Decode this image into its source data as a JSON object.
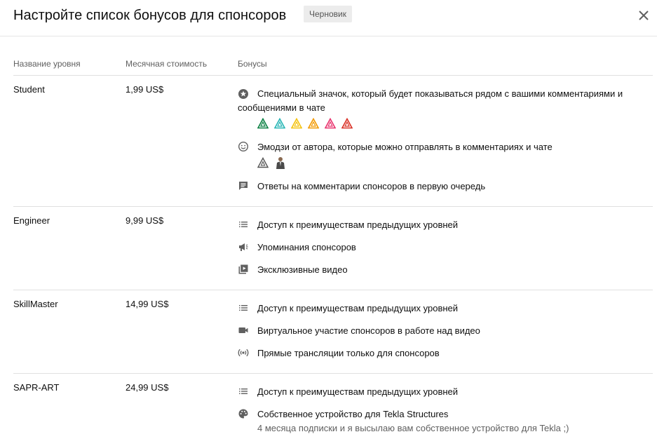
{
  "dialog": {
    "title": "Настройте список бонусов для спонсоров",
    "status_badge": "Черновик"
  },
  "table": {
    "col_tier": "Название уровня",
    "col_price": "Месячная стоимость",
    "col_perks": "Бонусы"
  },
  "colors": {
    "loyalty_badges": [
      "#0b8043",
      "#26b5b5",
      "#f4c20d",
      "#f29900",
      "#e8336d",
      "#d93025"
    ]
  },
  "tiers": [
    {
      "name": "Student",
      "price": "1,99 US$",
      "perks": [
        {
          "icon": "star-badge-icon",
          "text": "Специальный значок, который будет показываться рядом с вашими комментариями и сообщениями в чате"
        },
        {
          "icon": "smiley-icon",
          "text": "Эмодзи от автора, которые можно отправлять в комментариях и чате"
        },
        {
          "icon": "comment-icon",
          "text": "Ответы на комментарии спонсоров в первую очередь"
        }
      ]
    },
    {
      "name": "Engineer",
      "price": "9,99 US$",
      "perks": [
        {
          "icon": "list-icon",
          "text": "Доступ к преимуществам предыдущих уровней"
        },
        {
          "icon": "megaphone-icon",
          "text": "Упоминания спонсоров"
        },
        {
          "icon": "video-library-icon",
          "text": "Эксклюзивные видео"
        }
      ]
    },
    {
      "name": "SkillMaster",
      "price": "14,99 US$",
      "perks": [
        {
          "icon": "list-icon",
          "text": "Доступ к преимуществам предыдущих уровней"
        },
        {
          "icon": "camera-icon",
          "text": "Виртуальное участие спонсоров в работе над видео"
        },
        {
          "icon": "live-broadcast-icon",
          "text": "Прямые трансляции только для спонсоров"
        }
      ]
    },
    {
      "name": "SAPR-ART",
      "price": "24,99 US$",
      "perks": [
        {
          "icon": "list-icon",
          "text": "Доступ к преимуществам предыдущих уровней"
        },
        {
          "icon": "palette-icon",
          "text": "Собственное устройство для Tekla Structures",
          "sub": "4 месяца подписки и я высылаю вам собственное устройство для Tekla ;)"
        }
      ]
    }
  ]
}
